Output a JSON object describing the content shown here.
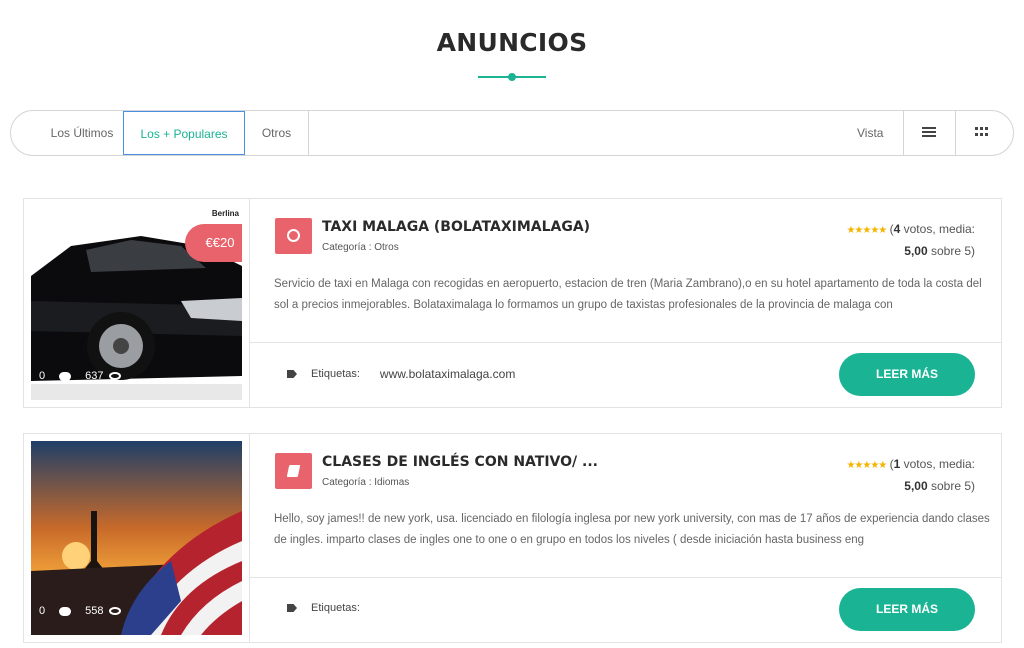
{
  "page": {
    "title": "ANUNCIOS"
  },
  "toolbar": {
    "tabs": [
      {
        "label": "Los Últimos"
      },
      {
        "label": "Los + Populares"
      },
      {
        "label": "Otros"
      }
    ],
    "vista_label": "Vista"
  },
  "listings": [
    {
      "title": "TAXI MALAGA (BOLATAXIMALAGA)",
      "category": "Categoría : Otros",
      "price": "€€20",
      "thumb_brand": "Berlina",
      "comments": "0",
      "views": "637",
      "rating_prefix": "(",
      "votes": "4",
      "votes_suffix": " votos, media:",
      "average": "5,00",
      "average_suffix": " sobre 5)",
      "description": "Servicio de taxi en Malaga con recogidas en aeropuerto, estacion de tren (Maria Zambrano),o en su hotel apartamento de toda la costa del sol a precios inmejorables. Bolataximalaga lo formamos un grupo de taxistas profesionales de la provincia de malaga con",
      "tags_label": "Etiquetas:",
      "tags_value": "www.bolataximalaga.com",
      "button": "LEER MÁS",
      "icon": "gear-icon"
    },
    {
      "title": "CLASES DE INGLÉS CON NATIVO/ ...",
      "category": "Categoría : Idiomas",
      "comments": "0",
      "views": "558",
      "rating_prefix": "(",
      "votes": "1",
      "votes_suffix": " votos, media:",
      "average": "5,00",
      "average_suffix": " sobre 5)",
      "description": "Hello, soy james!! de new york, usa. licenciado en filología inglesa por new york university, con mas de 17 años de experiencia dando clases de ingles. imparto clases de ingles one to one o en grupo en todos los niveles ( desde iniciación hasta business eng",
      "tags_label": "Etiquetas:",
      "tags_value": "",
      "button": "LEER MÁS",
      "icon": "book-icon"
    }
  ],
  "colors": {
    "accent": "#1ab394",
    "category": "#e8636b",
    "star": "#f5b400"
  }
}
